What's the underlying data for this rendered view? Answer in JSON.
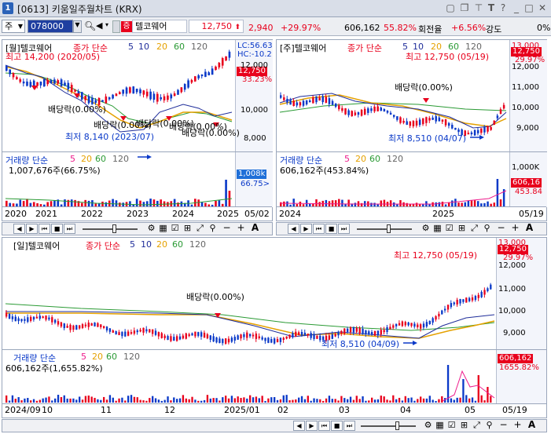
{
  "window": {
    "number": "1",
    "title": "[0613] 키움일주월차트 (KRX)",
    "buttons": [
      "restore-icon",
      "copy-icon",
      "pin-icon",
      "T",
      "?",
      "minimize-icon",
      "maximize-icon",
      "close-icon"
    ]
  },
  "toolbar": {
    "market_select": "주",
    "code_input": "078000",
    "stock_tag": "증",
    "stock_name": "텔코웨어",
    "price": "12,750",
    "change": "2,940",
    "change_pct": "+29.97%",
    "volume": "606,162",
    "turnover_pct": "55.82%",
    "turnover_label": "회전율",
    "turnover_change": "+6.56%",
    "strength_label": "강도",
    "strength_value": "0%"
  },
  "colors": {
    "up": "#e8001c",
    "down": "#0a39c8",
    "ma5": "#ee1c8c",
    "ma10": "#1f2d9a",
    "ma20": "#e5a100",
    "ma60": "#2a9a34",
    "ma120": "#8a8a8a",
    "vol_up": "#e8001c",
    "vol_down": "#0a39c8"
  },
  "monthly_chart": {
    "name": "[월]텔코웨어",
    "legend_title": "종가 단순",
    "ma_periods": [
      "5",
      "10",
      "20",
      "60",
      "120"
    ],
    "high_text": "최고 14,200 (2020/05)",
    "low_text": "최저 8,140 (2023/07)",
    "dividends": [
      "배당락(0.00%)",
      "배당락(0.00%)",
      "배당락(0.00%)",
      "배당락(0.00%)",
      "배당락(0.00%)"
    ],
    "side": {
      "lc": "LC:56.63",
      "hc": "HC:-10.2",
      "price": "12,750",
      "pct": "33.23%"
    },
    "y_ticks": [
      "12,000",
      "10,000",
      "8,000"
    ],
    "volume_title": "거래량 단순",
    "volume_ma": [
      "5",
      "20",
      "60",
      "120"
    ],
    "volume_value": "1,007,676주(66.75%)",
    "volume_side": [
      "1,008k",
      "66.75>"
    ],
    "x_ticks": [
      "2020",
      "2021",
      "2022",
      "2023",
      "2024",
      "2025",
      "05/02"
    ]
  },
  "weekly_chart": {
    "name": "[주]텔코웨어",
    "legend_title": "종가 단순",
    "ma_periods": [
      "5",
      "10",
      "20",
      "60",
      "120"
    ],
    "high_text": "최고 12,750 (05/19)",
    "low_text": "최저 8,510 (04/07)",
    "dividend": "배당락(0.00%)",
    "side": {
      "top": "13,000",
      "price": "12,750",
      "pct": "29.97%"
    },
    "y_ticks": [
      "12,000",
      "11,000",
      "10,000",
      "9,000"
    ],
    "volume_title": "거래량 단순",
    "volume_ma": [
      "5",
      "20",
      "60",
      "120"
    ],
    "volume_value": "606,162주(453.84%)",
    "volume_side": [
      "606,16",
      "453.84"
    ],
    "volume_ticks": [
      "1,000K",
      "500K"
    ],
    "x_ticks": [
      "2024",
      "2025",
      "05/19"
    ]
  },
  "daily_chart": {
    "name": "[일]텔코웨어",
    "legend_title": "종가 단순",
    "ma_periods": [
      "5",
      "10",
      "20",
      "60",
      "120"
    ],
    "high_text": "최고 12,750 (05/19)",
    "low_text": "최저 8,510 (04/09)",
    "dividend": "배당락(0.00%)",
    "side": {
      "top": "13,000",
      "price": "12,750",
      "pct": "29.97%"
    },
    "y_ticks": [
      "12,000",
      "11,000",
      "10,000",
      "9,000"
    ],
    "volume_title": "거래량 단순",
    "volume_ma": [
      "5",
      "20",
      "60",
      "120"
    ],
    "volume_value": "606,162주(1,655.82%)",
    "volume_side": [
      "606,162",
      "1655.82%"
    ],
    "x_ticks": [
      "2024/09",
      "10",
      "11",
      "12",
      "2025/01",
      "02",
      "03",
      "04",
      "05",
      "05/19"
    ]
  },
  "chart_controls": [
    "◀",
    "▶",
    "⏮",
    "⏹",
    "⏭",
    "zoom-slider",
    "gear-icon",
    "grid-icon",
    "checkbox-icon",
    "crosshair-icon",
    "fit-icon",
    "search-icon",
    "−",
    "+",
    "A"
  ]
}
